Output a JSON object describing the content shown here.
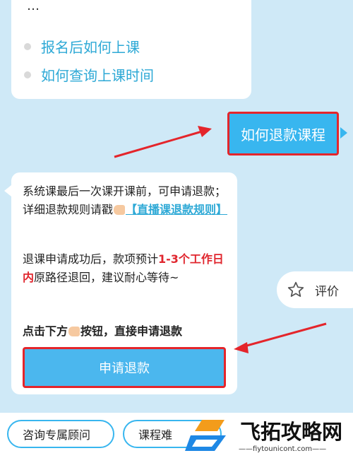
{
  "faq": {
    "partial_title": "…",
    "items": [
      {
        "label": "报名后如何上课"
      },
      {
        "label": "如何查询上课时间"
      }
    ]
  },
  "user_message": "如何退款课程",
  "reply": {
    "para1_text": "系统课最后一次课开课前，可申请退款；详细退款规则请戳",
    "para1_link": "【直播课退款规则】",
    "para2_pre": "退课申请成功后，款项预计",
    "para2_highlight": "1-3个工作日内",
    "para2_post": "原路径退回，建议耐心等待~",
    "para3_pre": "点击下方",
    "para3_post": "按钮，直接申请退款",
    "apply_button": "申请退款"
  },
  "rate": {
    "icon": "star-outline-icon",
    "label": "评价"
  },
  "quick_buttons": [
    {
      "label": "咨询专属顾问"
    },
    {
      "label": "课程难"
    }
  ],
  "watermark": {
    "name": "飞拓攻略网",
    "url": "——fiytounicont.com——"
  },
  "colors": {
    "background": "#cfe9f7",
    "accent_blue": "#38b6ef",
    "link_blue": "#2ea9d6",
    "highlight_red": "#e0262e",
    "annotation_red": "#e4252b"
  }
}
